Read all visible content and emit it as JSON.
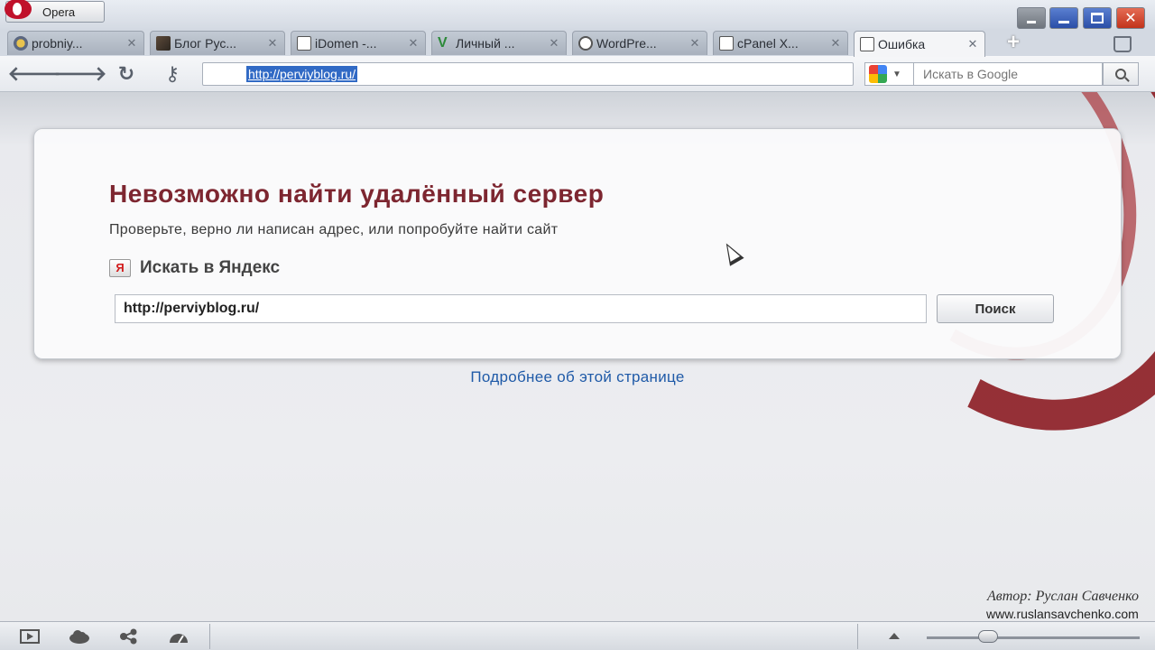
{
  "window": {
    "menu_button_label": "Opera"
  },
  "tabs": [
    {
      "label": "probniy...",
      "icon": "circle-favicon-icon",
      "active": false
    },
    {
      "label": "Блог Рус...",
      "icon": "photo-favicon-icon",
      "active": false
    },
    {
      "label": "iDomen -...",
      "icon": "page-icon",
      "active": false
    },
    {
      "label": "Личный ...",
      "icon": "v-favicon-icon",
      "active": false
    },
    {
      "label": "WordPre...",
      "icon": "wordpress-icon",
      "active": false
    },
    {
      "label": "cPanel X...",
      "icon": "page-icon",
      "active": false
    },
    {
      "label": "Ошибка",
      "icon": "page-icon",
      "active": true
    }
  ],
  "navbar": {
    "address": "http://perviyblog.ru/",
    "search_placeholder": "Искать в Google",
    "search_engine_icon": "google-icon"
  },
  "page": {
    "title": "Невозможно найти удалённый сервер",
    "description": "Проверьте, верно ли написан адрес, или попробуйте найти сайт",
    "yandex_heading": "Искать в Яндекс",
    "yandex_icon_letter": "Я",
    "yandex_query": "http://perviyblog.ru/",
    "yandex_button": "Поиск",
    "more_link": "Подробнее об этой странице"
  },
  "watermark": {
    "author": "Автор: Руслан Савченко",
    "url": "www.ruslansavchenko.com"
  },
  "colors": {
    "title": "#7d2630",
    "link": "#1f5aa8",
    "accent_ribbon": "#8c1c23",
    "selection": "#316ac5"
  }
}
